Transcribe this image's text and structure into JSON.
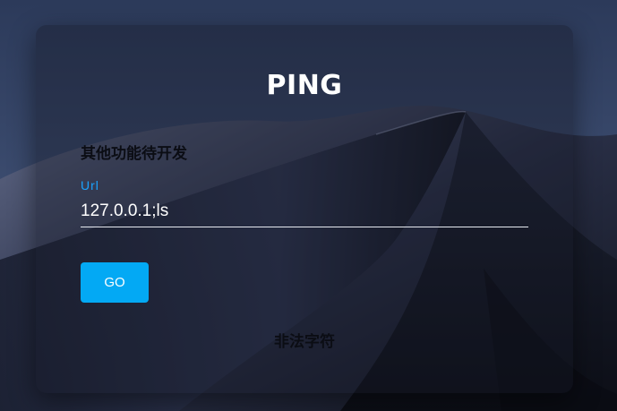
{
  "page": {
    "title": "PING",
    "notice": "其他功能待开发",
    "form": {
      "url_label": "Url",
      "url_value": "127.0.0.1;ls",
      "submit_label": "GO"
    },
    "result_message": "非法字符"
  },
  "colors": {
    "accent": "#03a9f4",
    "label_accent": "#1aa3ff",
    "title_text": "#ffffff",
    "dark_text": "#0b0d14"
  },
  "background": {
    "description_icon": "desert-dunes-wallpaper"
  }
}
